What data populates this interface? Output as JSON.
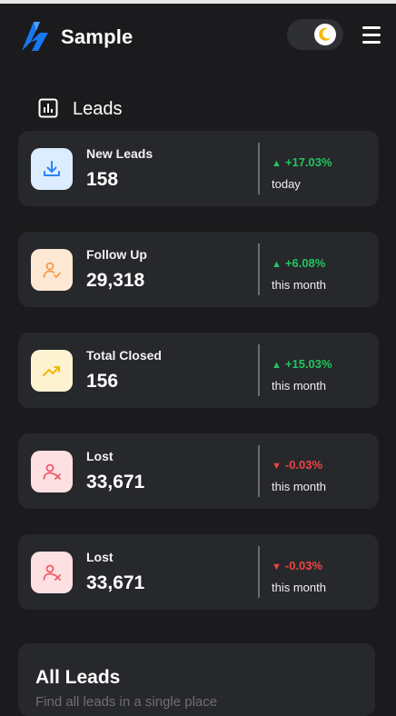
{
  "header": {
    "brand": "Sample",
    "logo_icon": "bolt-logo",
    "theme_toggle_icon": "moon-icon",
    "menu_icon": "hamburger-icon"
  },
  "section": {
    "title": "Leads",
    "icon": "bar-chart-icon"
  },
  "stats": [
    {
      "label": "New Leads",
      "value": "158",
      "change": "+17.03%",
      "trend": "up",
      "period": "today",
      "icon": "download-icon",
      "icon_bg": "#dcedff",
      "icon_color": "#2b83f6"
    },
    {
      "label": "Follow Up",
      "value": "29,318",
      "change": "+6.08%",
      "trend": "up",
      "period": "this month",
      "icon": "user-check-icon",
      "icon_bg": "#fde8d4",
      "icon_color": "#f29b4c"
    },
    {
      "label": "Total Closed",
      "value": "156",
      "change": "+15.03%",
      "trend": "up",
      "period": "this month",
      "icon": "trending-up-icon",
      "icon_bg": "#fdf3d1",
      "icon_color": "#f2b705"
    },
    {
      "label": "Lost",
      "value": "33,671",
      "change": "-0.03%",
      "trend": "down",
      "period": "this month",
      "icon": "user-x-icon",
      "icon_bg": "#fde0e2",
      "icon_color": "#ef5a68"
    },
    {
      "label": "Lost",
      "value": "33,671",
      "change": "-0.03%",
      "trend": "down",
      "period": "this month",
      "icon": "user-x-icon",
      "icon_bg": "#fde0e2",
      "icon_color": "#ef5a68"
    }
  ],
  "arrows": {
    "up": "▲",
    "down": "▼"
  },
  "panel": {
    "title": "All Leads",
    "subtitle": "Find all leads in a single place"
  },
  "colors": {
    "background": "#1b1b1d",
    "card": "#27282c",
    "positive": "#22c55e",
    "negative": "#ef4444",
    "brand_blue": "#1877f2"
  }
}
